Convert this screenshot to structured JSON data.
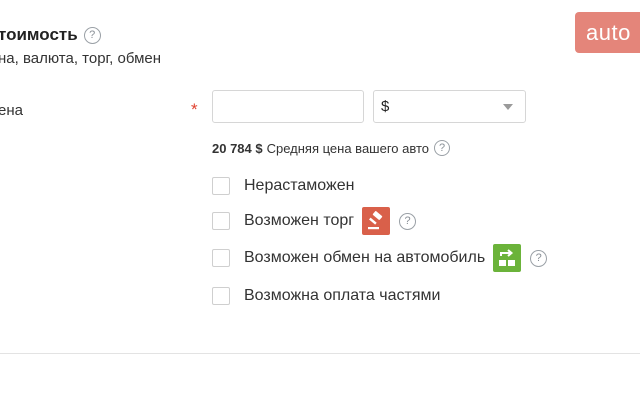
{
  "section": {
    "title": "тоимость",
    "subtitle": "на, валюта, торг, обмен"
  },
  "logo": {
    "text": "auto"
  },
  "price": {
    "label": "ена",
    "required_mark": "*",
    "input_value": "",
    "currency": "$"
  },
  "average": {
    "value": "20 784 $",
    "text": "Средняя цена вашего авто"
  },
  "options": [
    {
      "label": "Нерастаможен",
      "checked": false
    },
    {
      "label": "Возможен торг",
      "checked": false,
      "icon": "auction-gavel-icon"
    },
    {
      "label": "Возможен обмен на автомобиль",
      "checked": false,
      "icon": "car-exchange-icon"
    },
    {
      "label": "Возможна оплата частями",
      "checked": false
    }
  ],
  "help_glyph": "?",
  "colors": {
    "required": "#e0402e",
    "logo_bg": "#e4857a",
    "gavel_badge": "#d9604a",
    "exchange_badge": "#6bb33a"
  }
}
